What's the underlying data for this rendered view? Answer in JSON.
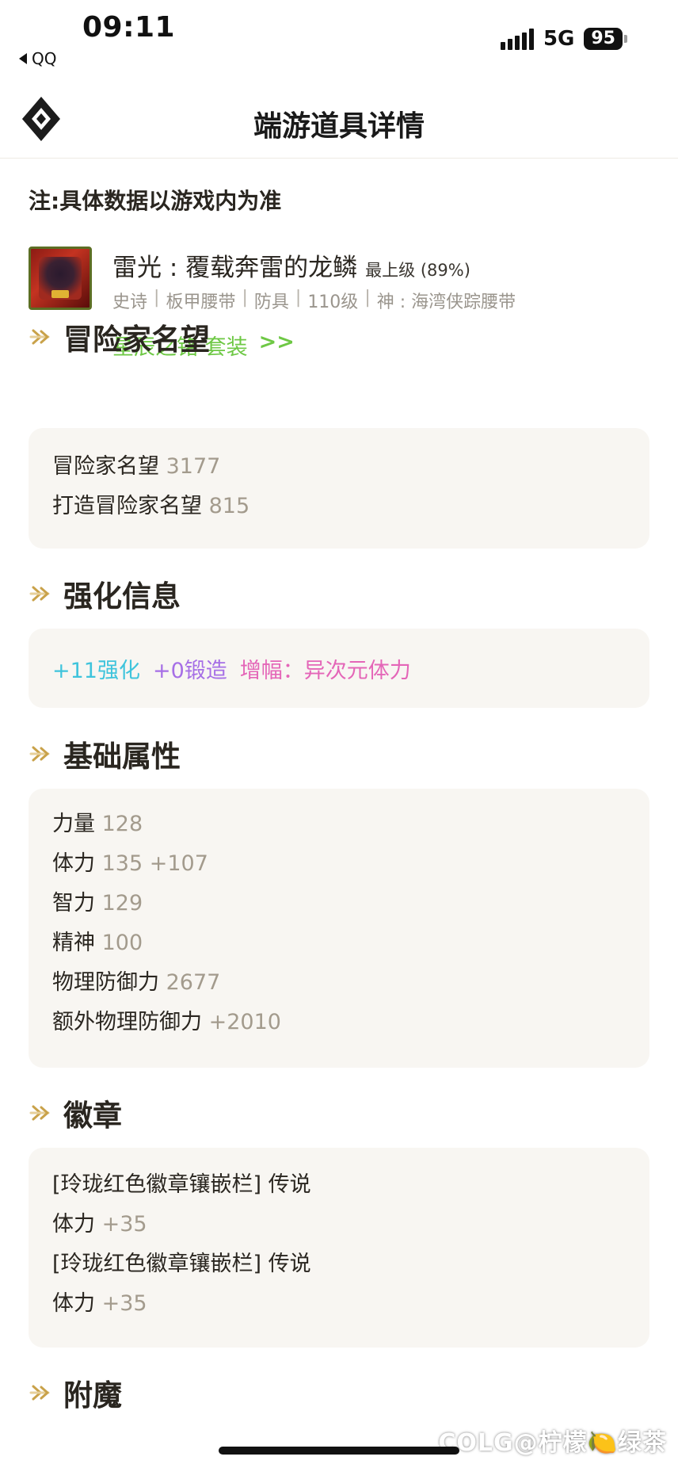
{
  "status": {
    "time": "09:11",
    "back_app": "QQ",
    "network": "5G",
    "battery": "95"
  },
  "header": {
    "title": "端游道具详情"
  },
  "note": "注:具体数据以游戏内为准",
  "item": {
    "name": "雷光 : 覆载奔雷的龙鳞",
    "grade": "最上级 (89%)",
    "meta": [
      "史诗",
      "板甲腰带",
      "防具",
      "110级",
      "神 : 海湾侠踪腰带"
    ],
    "set_name": "星辰之铭 套装",
    "set_arrow": ">>"
  },
  "sections": {
    "fame": {
      "title": "冒险家名望",
      "rows": [
        {
          "label": "冒险家名望",
          "value": "3177"
        },
        {
          "label": "打造冒险家名望",
          "value": "815"
        }
      ]
    },
    "enhance": {
      "title": "强化信息",
      "reinforce": "+11强化",
      "forge": "+0锻造",
      "amplify": "增幅：异次元体力"
    },
    "base": {
      "title": "基础属性",
      "rows": [
        {
          "label": "力量",
          "value": "128"
        },
        {
          "label": "体力",
          "value": "135 +107"
        },
        {
          "label": "智力",
          "value": "129"
        },
        {
          "label": "精神",
          "value": "100"
        },
        {
          "label": "物理防御力",
          "value": "2677"
        },
        {
          "label": "额外物理防御力",
          "value": "+2010"
        }
      ]
    },
    "emblem": {
      "title": "徽章",
      "rows": [
        {
          "label": "[玲珑红色徽章镶嵌栏] 传说",
          "value": ""
        },
        {
          "label": "体力",
          "value": "+35"
        },
        {
          "label": "[玲珑红色徽章镶嵌栏] 传说",
          "value": ""
        },
        {
          "label": "体力",
          "value": "+35"
        }
      ]
    },
    "enchant": {
      "title": "附魔"
    }
  },
  "watermark": "COLG@柠檬🍋绿茶",
  "colors": {
    "accent_gold": "#c9a24a",
    "set_green": "#6ec845",
    "card_bg": "#f8f6f2",
    "value_gray": "#a39b8d"
  }
}
